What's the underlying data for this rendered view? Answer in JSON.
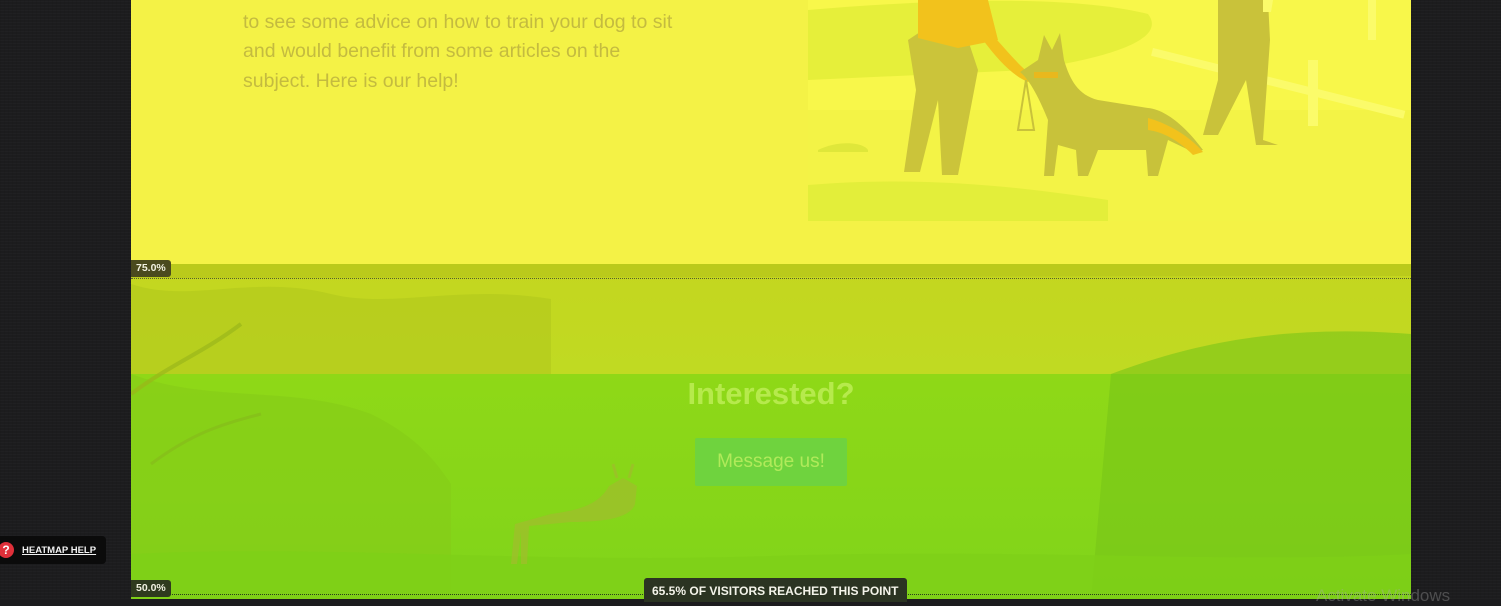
{
  "intro": {
    "text_line1": "to see some advice on how to train your dog to sit",
    "text_line2": "and would benefit from some articles on the",
    "text_line3": "subject. Here is our help!"
  },
  "cta": {
    "title": "Interested?",
    "button_label": "Message us!"
  },
  "heatmap": {
    "fold_75_label": "75.0%",
    "fold_50_label": "50.0%",
    "reach_badge": "65.5% OF VISITORS REACHED THIS POINT",
    "help_label": "HEATMAP HELP",
    "help_icon": "question-icon"
  },
  "os_watermark": "Activate Windows",
  "colors": {
    "heat_yellow": "#f4f246",
    "heat_lime": "#c0da22",
    "heat_green": "#80d41a",
    "help_icon_red": "#e0303a",
    "page_background": "#1c1c1e"
  }
}
